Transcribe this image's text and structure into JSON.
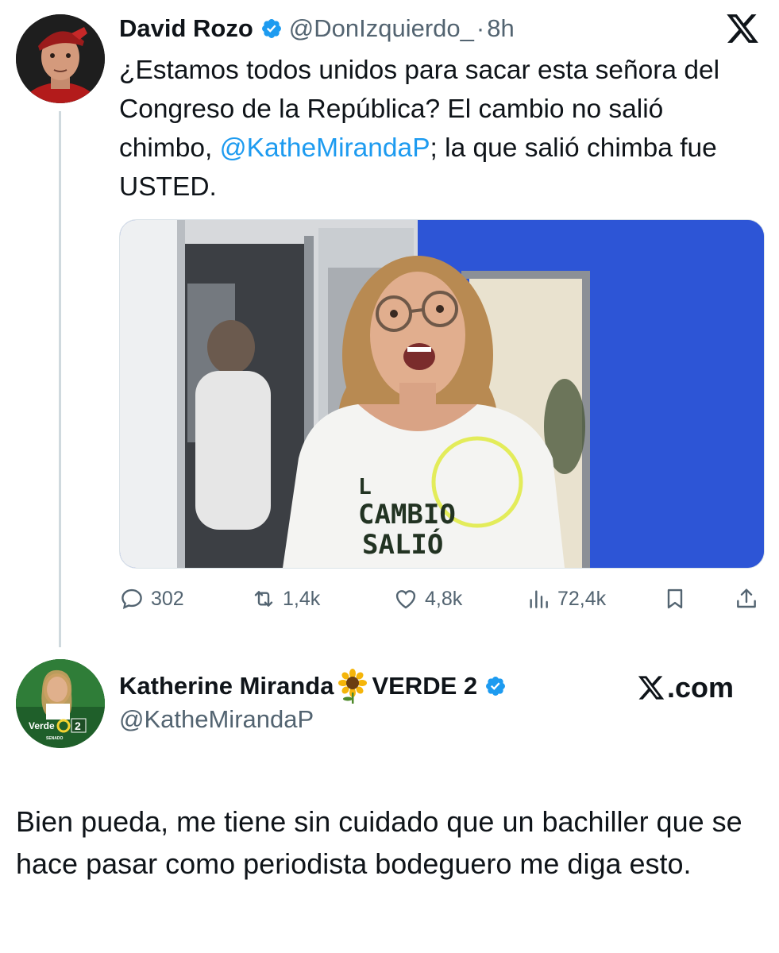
{
  "tweet": {
    "author_name": "David Rozo",
    "author_handle": "@DonIzquierdo_",
    "separator": "·",
    "time": "8h",
    "text_before_mention": "¿Estamos todos unidos para sacar esta señora del Congreso de la República? El cambio no salió chimbo, ",
    "mention": "@KatheMirandaP",
    "text_after_mention": "; la que salió chimba fue USTED.",
    "media": {
      "shirt_lines": [
        "L",
        "CAMBIO",
        "SALIÓ"
      ]
    },
    "stats": {
      "replies": "302",
      "reposts": "1,4k",
      "likes": "4,8k",
      "views": "72,4k"
    }
  },
  "quoted": {
    "author_name": "Katherine Miranda",
    "name_suffix": "VERDE 2",
    "author_handle": "@KatheMirandaP",
    "site": ".com",
    "avatar": {
      "party_label": "Verde",
      "number": "2",
      "caption": "SENADO"
    },
    "reply_text": "Bien pueda, me tiene sin cuidado que un bachiller que se hace pasar como periodista bodeguero me diga esto."
  },
  "colors": {
    "accent": "#1d9bf0",
    "muted": "#536471",
    "text": "#0f1419",
    "thread_line": "#cfd9de",
    "media_wall": "#2d55d6"
  }
}
